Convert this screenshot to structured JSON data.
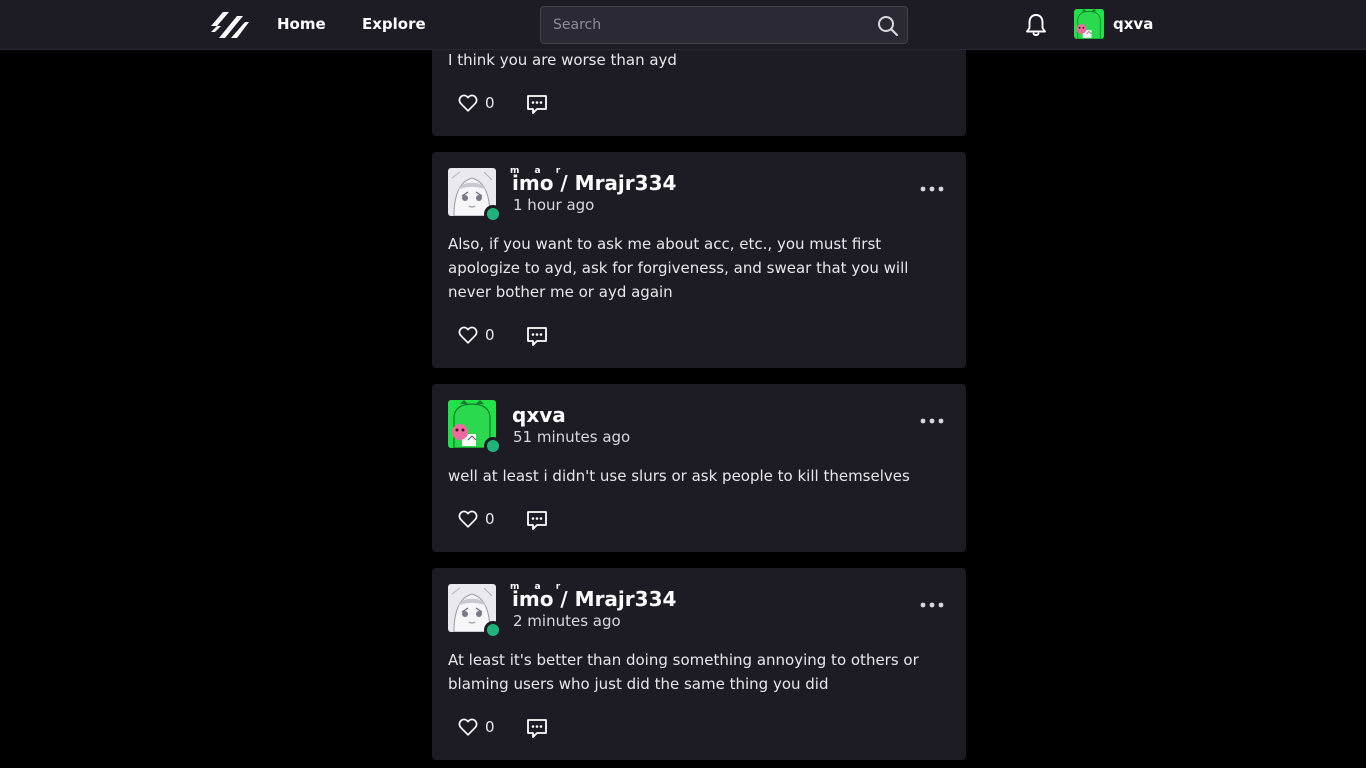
{
  "nav": {
    "home_label": "Home",
    "explore_label": "Explore",
    "search_placeholder": "Search",
    "account_name": "qxva"
  },
  "colors": {
    "background": "#000000",
    "surface": "#1d1c25",
    "online": "#1fb57a",
    "avatar_green": "#22e04a"
  },
  "posts": [
    {
      "text": "I think you are worse than ayd",
      "likes": "0"
    },
    {
      "ruby": "m a r",
      "author": "imo / Mrajr334",
      "time": "1 hour ago",
      "text": "Also, if you want to ask me about acc, etc., you must first apologize to ayd, ask for forgiveness, and swear that you will never bother me or ayd again",
      "likes": "0"
    },
    {
      "author": "qxva",
      "time": "51 minutes ago",
      "text": "well at least i didn't use slurs or ask people to kill themselves",
      "likes": "0"
    },
    {
      "ruby": "m a r",
      "author": "imo / Mrajr334",
      "time": "2 minutes ago",
      "text": "At least it's better than doing something annoying to others or blaming users who just did the same thing you did",
      "likes": "0"
    }
  ]
}
